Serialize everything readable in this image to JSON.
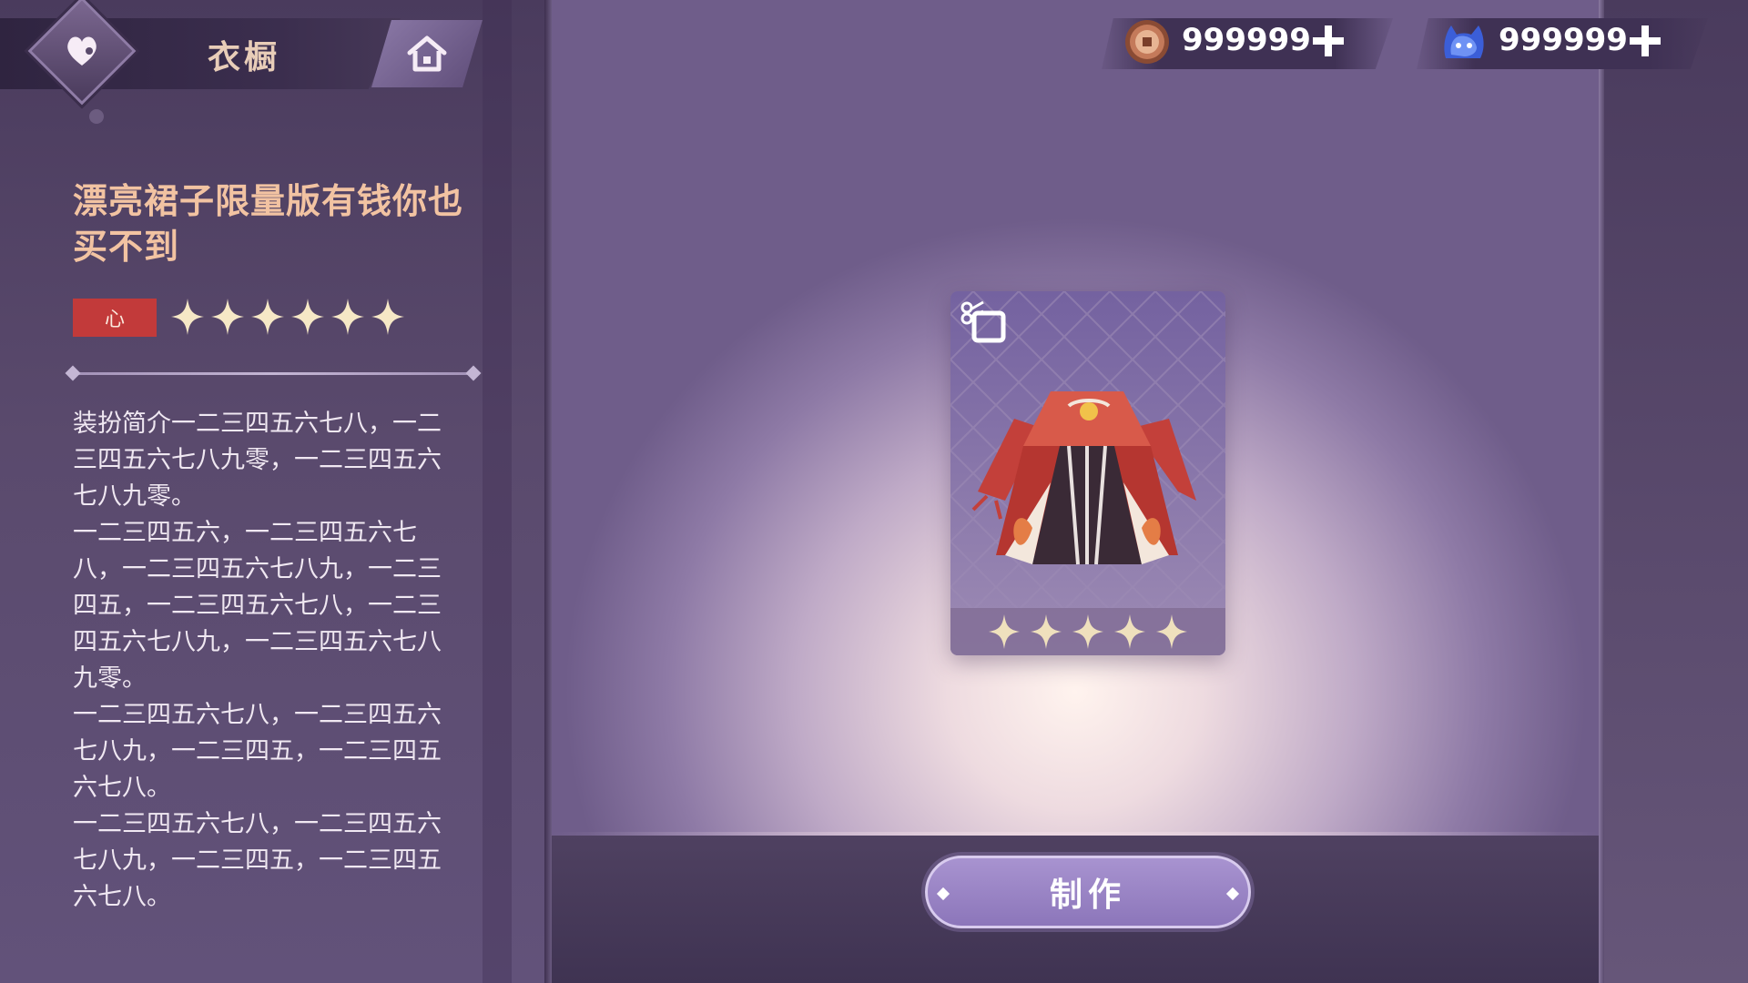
{
  "header": {
    "title": "衣橱"
  },
  "currencies": [
    {
      "icon": "coin-icon",
      "value": "999999"
    },
    {
      "icon": "cat-gem-icon",
      "value": "999999"
    }
  ],
  "item": {
    "name": "漂亮裙子限量版有钱你也买不到",
    "tag": "心",
    "stars": 6,
    "description": [
      "装扮简介一二三四五六七八，一二三四五六七八九零，一二三四五六七八九零。",
      "一二三四五六，一二三四五六七八，一二三四五六七八九，一二三四五，一二三四五六七八，一二三四五六七八九，一二三四五六七八九零。",
      "一二三四五六七八，一二三四五六七八九，一二三四五，一二三四五六七八。",
      "一二三四五六七八，一二三四五六七八九，一二三四五，一二三四五六七八。"
    ]
  },
  "card": {
    "stars": 5,
    "icon": "scissors-icon"
  },
  "actions": {
    "make_label": "制作"
  },
  "colors": {
    "accent": "#9a86c6",
    "tag_red": "#c23a3a",
    "title_gold": "#f2c3a2"
  }
}
